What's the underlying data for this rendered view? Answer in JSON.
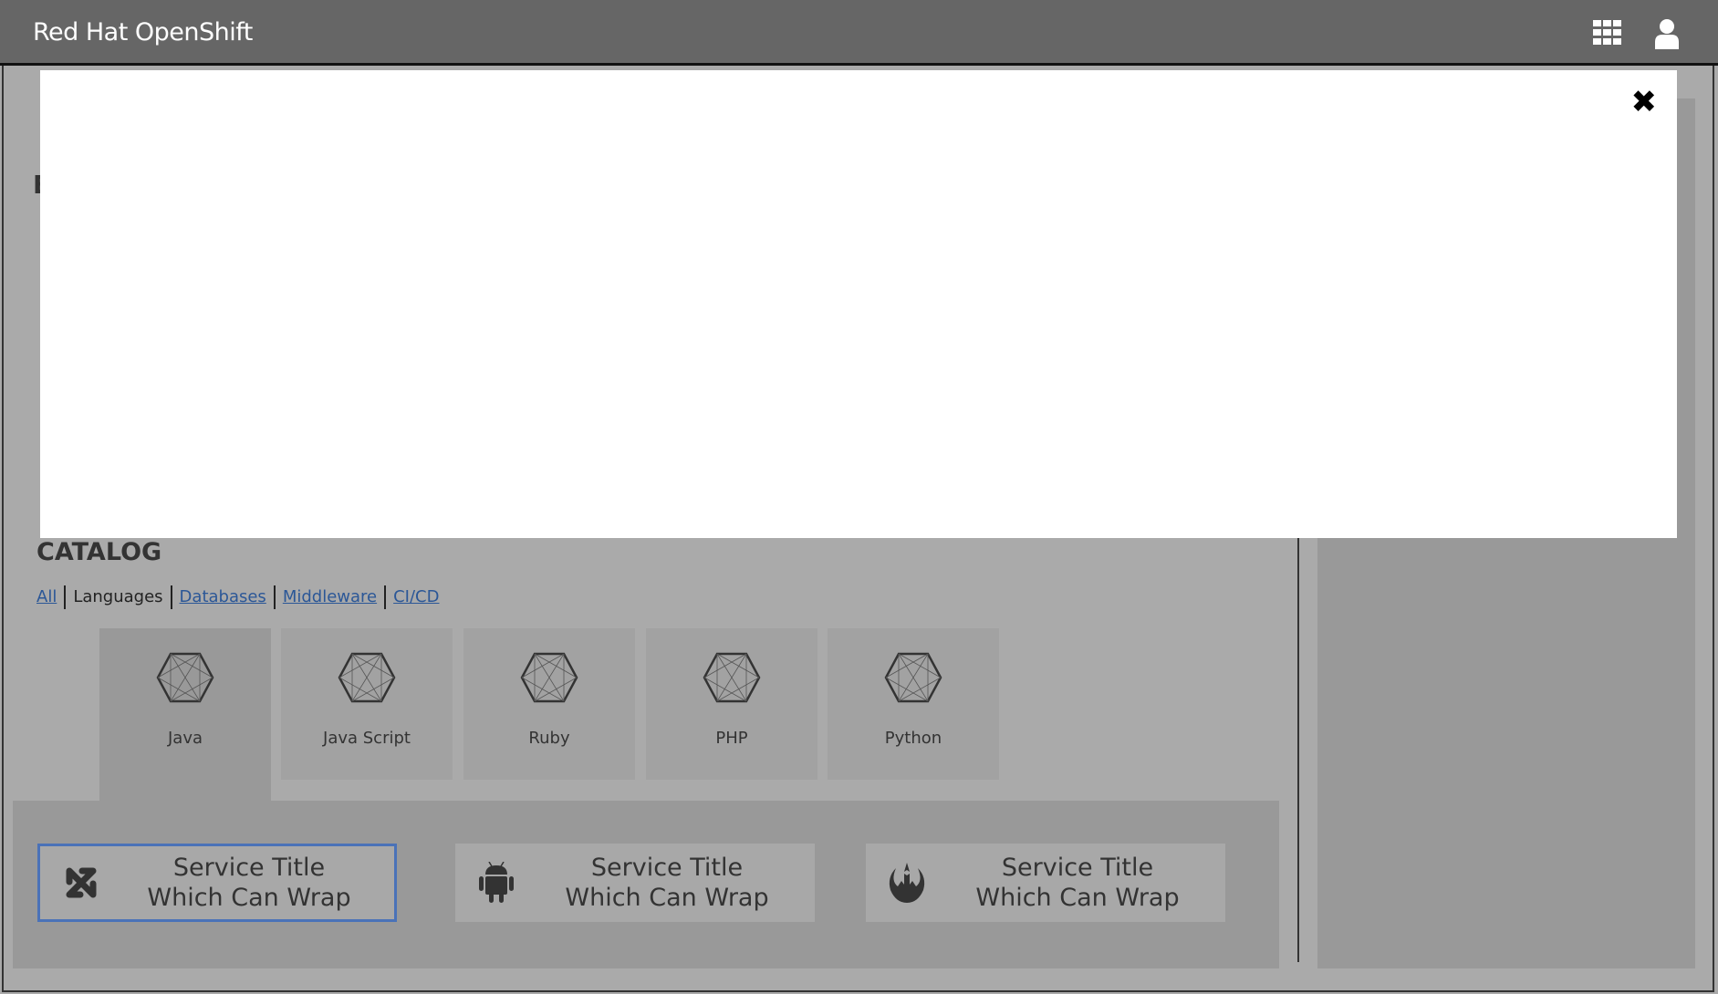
{
  "header": {
    "title": "Red Hat OpenShift",
    "icons": [
      "grid-icon",
      "user-icon"
    ]
  },
  "background": {
    "partial_heading": "E"
  },
  "modal": {
    "close_icon": "close-icon"
  },
  "catalog": {
    "title": "CATALOG",
    "tabs": [
      {
        "label": "All",
        "active": false
      },
      {
        "label": "Languages",
        "active": true
      },
      {
        "label": "Databases",
        "active": false
      },
      {
        "label": "Middleware",
        "active": false
      },
      {
        "label": "CI/CD",
        "active": false
      }
    ],
    "tiles": [
      {
        "label": "Java",
        "active": true
      },
      {
        "label": "Java Script"
      },
      {
        "label": "Ruby"
      },
      {
        "label": "PHP"
      },
      {
        "label": "Python"
      }
    ],
    "services": [
      {
        "line1": "Service Title",
        "line2": "Which Can Wrap",
        "icon": "joomla-icon",
        "selected": true
      },
      {
        "line1": "Service Title",
        "line2": "Which Can Wrap",
        "icon": "android-icon"
      },
      {
        "line1": "Service Title",
        "line2": "Which Can Wrap",
        "icon": "rebel-icon"
      }
    ]
  },
  "colors": {
    "header": "#666666",
    "link": "#2b5797",
    "selected_border": "#4a72b8"
  }
}
